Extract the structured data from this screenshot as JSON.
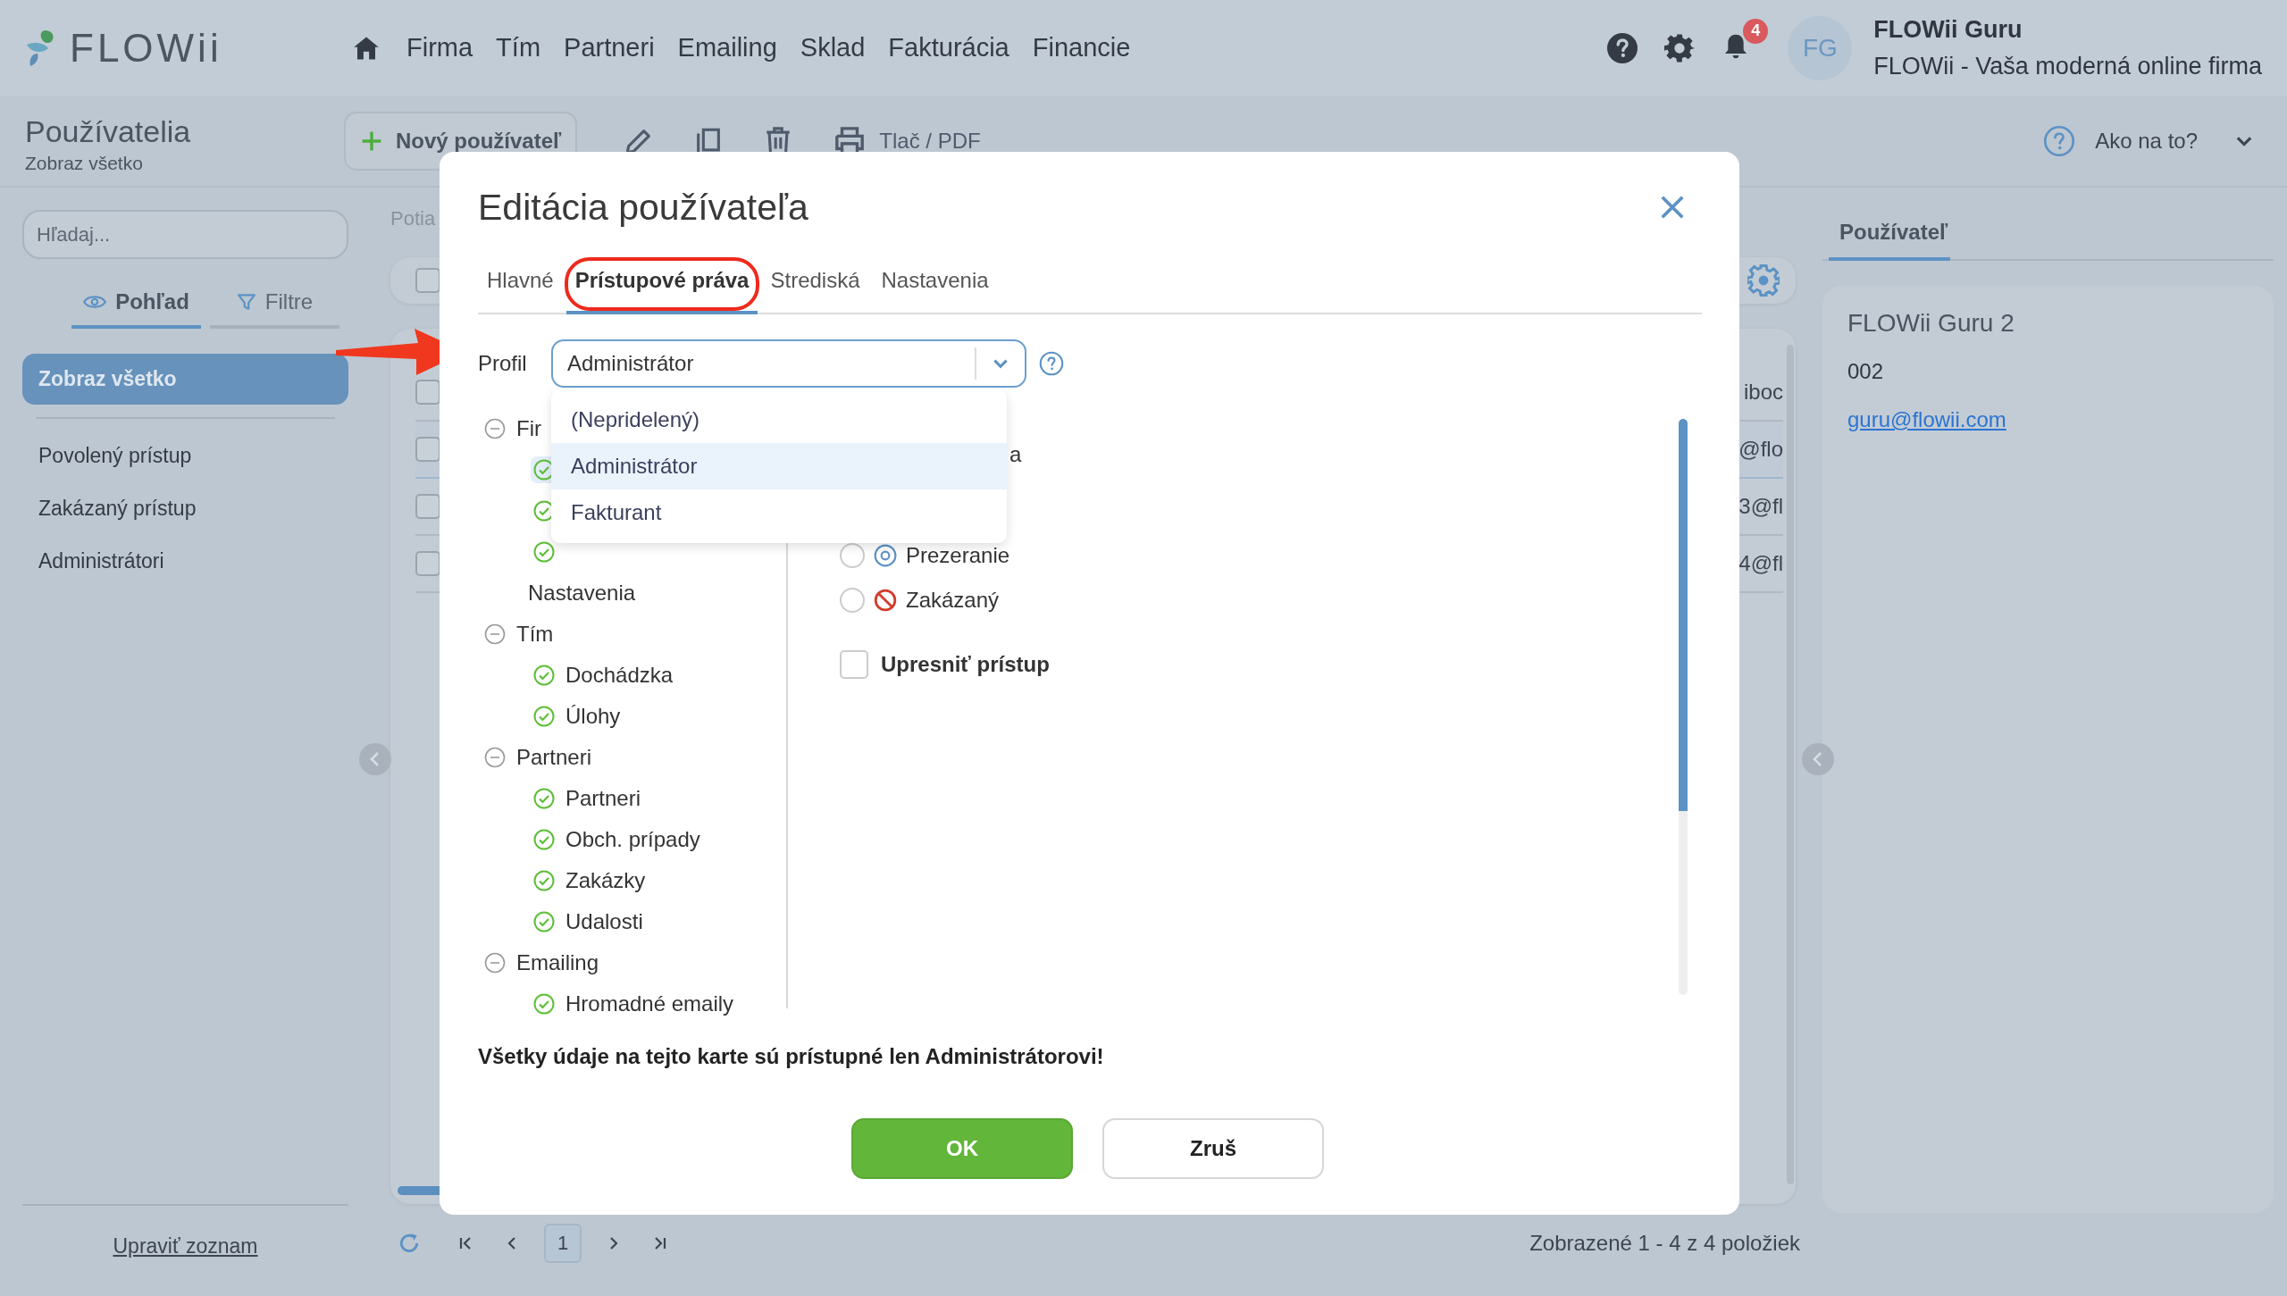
{
  "header": {
    "logo": "FLOWii",
    "nav": [
      "Firma",
      "Tím",
      "Partneri",
      "Emailing",
      "Sklad",
      "Fakturácia",
      "Financie"
    ],
    "notifications": "4",
    "avatar": "FG",
    "user_name": "FLOWii Guru",
    "company": "FLOWii - Vaša moderná online firma"
  },
  "toolbar": {
    "title": "Používatelia",
    "subtitle": "Zobraz všetko",
    "new_button": "Nový používateľ",
    "print": "Tlač / PDF",
    "help": "Ako na to?"
  },
  "sidebar": {
    "search": {
      "placeholder": "Hľadaj..."
    },
    "tabs": [
      {
        "label": "Pohľad",
        "selected": true
      },
      {
        "label": "Filtre",
        "selected": false
      }
    ],
    "items": [
      {
        "label": "Zobraz všetko",
        "selected": true
      },
      {
        "label": "Povolený prístup",
        "selected": false
      },
      {
        "label": "Zakázaný prístup",
        "selected": false
      },
      {
        "label": "Administrátori",
        "selected": false
      }
    ],
    "edit_link": "Upraviť zoznam"
  },
  "list": {
    "heading": "Potia",
    "select_all": {
      "checked": false
    },
    "rows": [
      {
        "text": "iboc",
        "selected": false,
        "checked": false
      },
      {
        "text": "@flo",
        "selected": true,
        "checked": false
      },
      {
        "text": "3@fl",
        "selected": false,
        "checked": false
      },
      {
        "text": "4@fl",
        "selected": false,
        "checked": false
      }
    ]
  },
  "pagination": {
    "page": "1",
    "summary": "Zobrazené 1 - 4 z 4 položiek"
  },
  "detail": {
    "tab": "Používateľ",
    "name": "FLOWii Guru 2",
    "code": "002",
    "email": "guru@flowii.com"
  },
  "dialog": {
    "title": "Editácia používateľa",
    "tabs": [
      {
        "label": "Hlavné",
        "selected": false,
        "highlighted": false
      },
      {
        "label": "Prístupové práva",
        "selected": true,
        "highlighted": true
      },
      {
        "label": "Strediská",
        "selected": false,
        "highlighted": false
      },
      {
        "label": "Nastavenia",
        "selected": false,
        "highlighted": false
      }
    ],
    "profile": {
      "label": "Profil",
      "value": "Administrátor",
      "pointed": true,
      "expanded": true,
      "options": [
        {
          "label": "(Nepridelený)",
          "selected": false
        },
        {
          "label": "Administrátor",
          "selected": true
        },
        {
          "label": "Fakturant",
          "selected": false
        }
      ]
    },
    "tree": [
      {
        "label": "Fir",
        "expanded": true,
        "children": [
          {
            "kind": "check",
            "selected": true
          },
          {
            "kind": "check",
            "selected": false
          },
          {
            "kind": "check",
            "selected": false
          },
          {
            "kind": "plain",
            "label": "Nastavenia"
          }
        ]
      },
      {
        "label": "Tím",
        "expanded": true,
        "children": [
          {
            "kind": "check",
            "label": "Dochádzka",
            "selected": false
          },
          {
            "kind": "check",
            "label": "Úlohy",
            "selected": false
          }
        ]
      },
      {
        "label": "Partneri",
        "expanded": true,
        "children": [
          {
            "kind": "check",
            "label": "Partneri",
            "selected": false
          },
          {
            "kind": "check",
            "label": "Obch. prípady",
            "selected": false
          },
          {
            "kind": "check",
            "label": "Zakázky",
            "selected": false
          },
          {
            "kind": "check",
            "label": "Udalosti",
            "selected": false
          }
        ]
      },
      {
        "label": "Emailing",
        "expanded": true,
        "children": [
          {
            "kind": "check",
            "label": "Hromadné emaily",
            "selected": false
          }
        ]
      }
    ],
    "access": [
      {
        "kind": "text",
        "label": "a"
      },
      {
        "kind": "radio",
        "label": "Prezeranie",
        "selected": false
      },
      {
        "kind": "radio",
        "label": "Zakázaný",
        "selected": false
      },
      {
        "kind": "checkbox",
        "label": "Upresniť prístup",
        "checked": false
      }
    ],
    "note": "Všetky údaje na tejto karte sú prístupné len Administrátorovi!",
    "ok": "OK",
    "cancel": "Zruš"
  }
}
